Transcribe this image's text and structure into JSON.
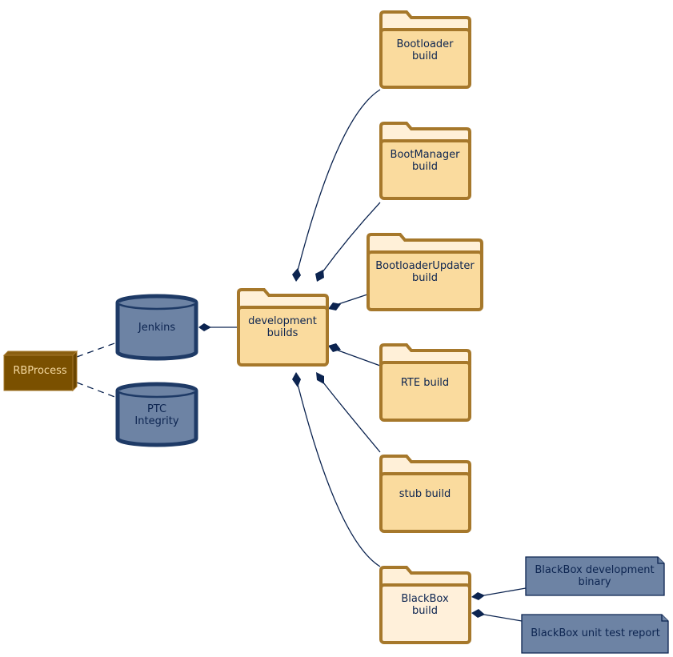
{
  "colors": {
    "folder_fill": "#fadb9e",
    "folder_tab": "#fff0d8",
    "folder_border": "#a6782b",
    "datastore_fill": "#6d83a4",
    "datastore_border": "#1e3a66",
    "node_fill": "#7a5000",
    "node_text": "#f5d9a0",
    "text": "#0c2450"
  },
  "nodes": {
    "rbprocess": {
      "label": "RBProcess"
    },
    "jenkins": {
      "label": "Jenkins"
    },
    "ptc": {
      "line1": "PTC",
      "line2": "Integrity"
    },
    "dev": {
      "line1": "development",
      "line2": "builds"
    },
    "bootloader": {
      "line1": "Bootloader",
      "line2": "build"
    },
    "bootmanager": {
      "line1": "BootManager",
      "line2": "build"
    },
    "bootloaderupdater": {
      "line1": "BootloaderUpdater",
      "line2": "build"
    },
    "rte": {
      "label": "RTE build"
    },
    "stub": {
      "label": "stub build"
    },
    "blackbox": {
      "line1": "BlackBox",
      "line2": "build"
    },
    "bb_binary": {
      "line1": "BlackBox development",
      "line2": "binary"
    },
    "bb_report": {
      "label": "BlackBox unit test report"
    }
  }
}
